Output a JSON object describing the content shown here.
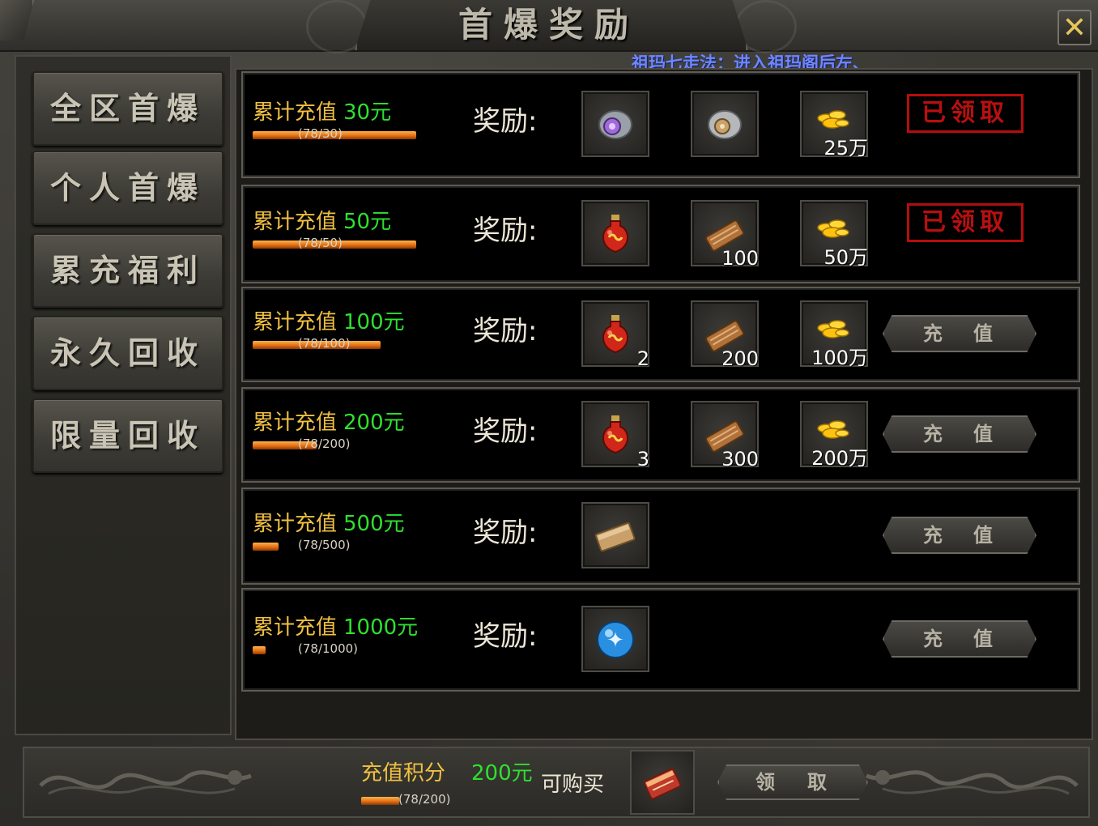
{
  "window": {
    "title": "首爆奖励",
    "close_glyph": "✕",
    "marquee": "祖玛七走法：进入祖玛阁后左、"
  },
  "sidebar": {
    "items": [
      {
        "label": "全区首爆"
      },
      {
        "label": "个人首爆"
      },
      {
        "label": "累充福利"
      },
      {
        "label": "永久回收"
      },
      {
        "label": "限量回收"
      }
    ]
  },
  "reward_label": "奖励:",
  "rows": [
    {
      "prefix": "累计充值",
      "amount": "30元",
      "progress_text": "(78/30)",
      "progress": 1.0,
      "rewards": [
        {
          "icon": "purple-ring-stone-icon",
          "qty": ""
        },
        {
          "icon": "gray-stone-icon",
          "qty": ""
        },
        {
          "icon": "gold-coins-icon",
          "qty": "25万"
        }
      ],
      "status": "claimed",
      "status_label": "已领取"
    },
    {
      "prefix": "累计充值",
      "amount": "50元",
      "progress_text": "(78/50)",
      "progress": 1.0,
      "rewards": [
        {
          "icon": "red-potion-icon",
          "qty": ""
        },
        {
          "icon": "scroll-icon",
          "qty": "100"
        },
        {
          "icon": "gold-coins-icon",
          "qty": "50万"
        }
      ],
      "status": "claimed",
      "status_label": "已领取"
    },
    {
      "prefix": "累计充值",
      "amount": "100元",
      "progress_text": "(78/100)",
      "progress": 0.78,
      "rewards": [
        {
          "icon": "red-potion-icon",
          "qty": "2"
        },
        {
          "icon": "scroll-icon",
          "qty": "200"
        },
        {
          "icon": "gold-coins-icon",
          "qty": "100万"
        }
      ],
      "status": "recharge",
      "status_label": "充值"
    },
    {
      "prefix": "累计充值",
      "amount": "200元",
      "progress_text": "(78/200)",
      "progress": 0.39,
      "rewards": [
        {
          "icon": "red-potion-icon",
          "qty": "3"
        },
        {
          "icon": "scroll-icon",
          "qty": "300"
        },
        {
          "icon": "gold-coins-icon",
          "qty": "200万"
        }
      ],
      "status": "recharge",
      "status_label": "充值"
    },
    {
      "prefix": "累计充值",
      "amount": "500元",
      "progress_text": "(78/500)",
      "progress": 0.156,
      "rewards": [
        {
          "icon": "book-icon",
          "qty": ""
        }
      ],
      "status": "recharge",
      "status_label": "充值"
    },
    {
      "prefix": "累计充值",
      "amount": "1000元",
      "progress_text": "(78/1000)",
      "progress": 0.078,
      "rewards": [
        {
          "icon": "blue-orb-icon",
          "qty": ""
        }
      ],
      "status": "recharge",
      "status_label": "充值"
    }
  ],
  "footer": {
    "points_label": "充值积分",
    "points_value": "200元",
    "buy_label": "可购买",
    "progress_text": "(78/200)",
    "progress": 0.39,
    "item_icon": "red-book-icon",
    "claim_label": "领取"
  },
  "colors": {
    "gold_text": "#f0c040",
    "green_amount": "#2ee02e",
    "claimed_red": "#b50d0d",
    "marquee_blue": "#6f86ff"
  }
}
